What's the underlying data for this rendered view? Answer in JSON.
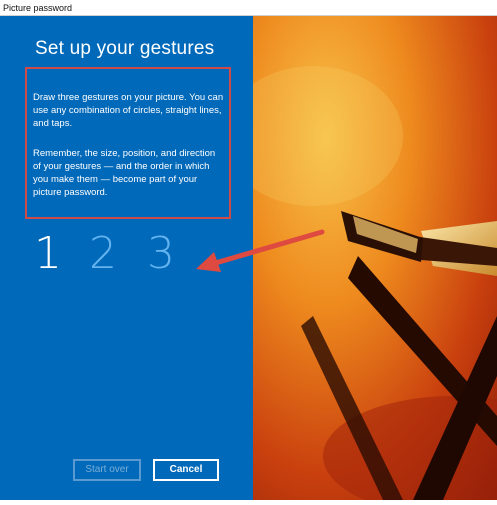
{
  "window": {
    "title": "Picture password"
  },
  "panel": {
    "heading": "Set up your gestures",
    "instructions_1": "Draw three gestures on your picture. You can use any combination of circles, straight lines, and taps.",
    "instructions_2": "Remember, the size, position, and direction of your gestures — and the order in which you make them — become part of your picture password."
  },
  "steps": [
    {
      "label": "1",
      "state": "active"
    },
    {
      "label": "2",
      "state": "pending"
    },
    {
      "label": "3",
      "state": "pending"
    }
  ],
  "buttons": {
    "start_over": "Start over",
    "cancel": "Cancel"
  },
  "colors": {
    "panel": "#0169b9",
    "annotation": "#d04a4a",
    "step_active": "#ffffff",
    "step_pending": "#63b3f0"
  }
}
